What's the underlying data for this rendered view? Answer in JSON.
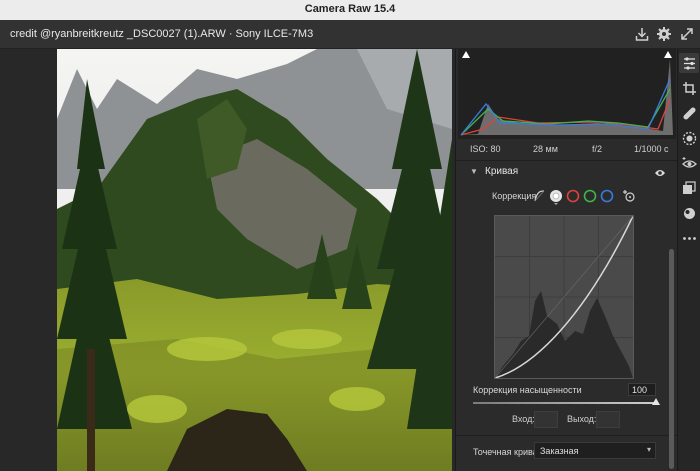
{
  "app": {
    "title": "Camera Raw 15.4"
  },
  "file": {
    "name": "credit @ryanbreitkreutz _DSC0027 (1).ARW  ·  Sony ILCE-7M3"
  },
  "toolbar": {
    "icons": [
      "save-icon",
      "gear-icon",
      "expand-icon"
    ]
  },
  "meta": {
    "iso": "ISO: 80",
    "focal": "28 мм",
    "aperture": "f/2",
    "shutter": "1/1000 с"
  },
  "section": {
    "title": "Кривая"
  },
  "correction": {
    "label": "Коррекция",
    "channels": [
      "parametric",
      "point",
      "red",
      "green",
      "blue"
    ]
  },
  "saturation": {
    "label": "Коррекция насыщенности",
    "value": "100"
  },
  "io": {
    "input_label": "Вход:",
    "output_label": "Выход:"
  },
  "point_curve": {
    "label": "Точечная кривая",
    "value": "Заказная"
  },
  "tools": [
    "edit-icon",
    "crop-icon",
    "healing-icon",
    "mask-icon",
    "redeye-icon",
    "presets-icon",
    "snapshots-icon",
    "more-icon"
  ],
  "colors": {
    "red": "#e0413c",
    "green": "#3fb54a",
    "blue": "#3a7be0"
  }
}
